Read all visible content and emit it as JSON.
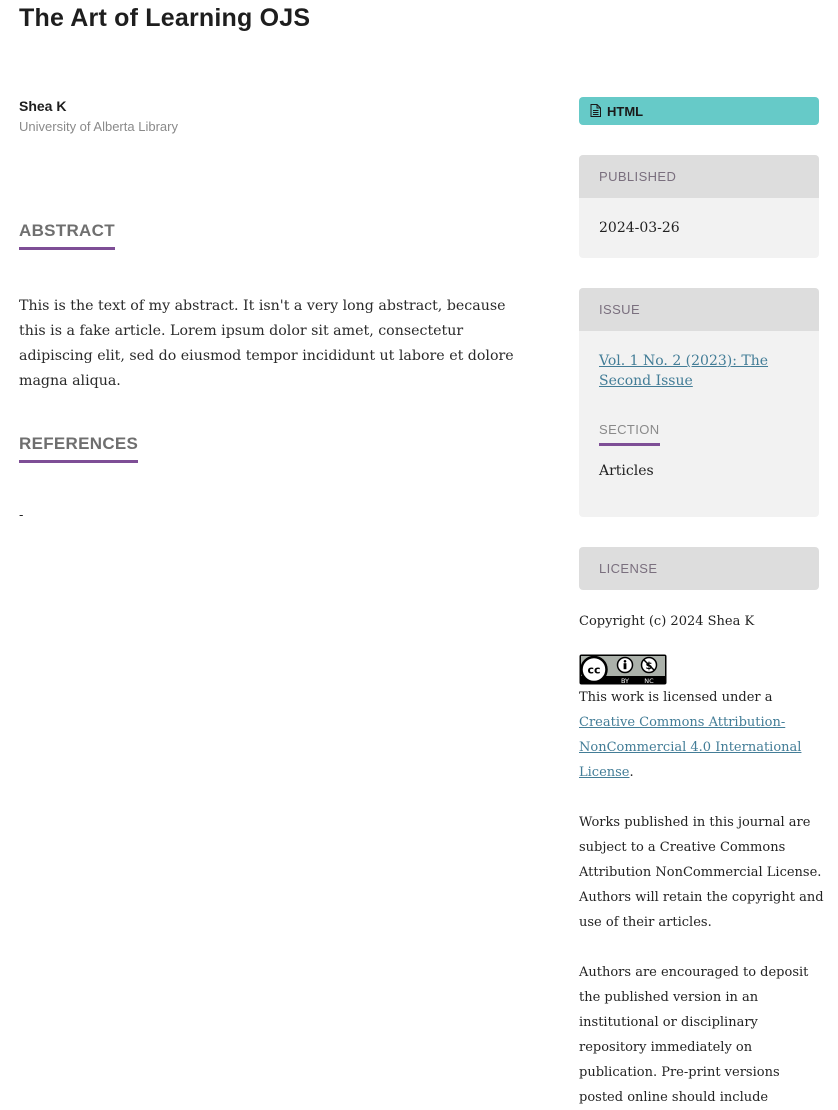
{
  "article": {
    "title": "The Art of Learning OJS",
    "author": {
      "name": "Shea K",
      "affiliation": "University of Alberta Library"
    },
    "abstract": {
      "heading": "ABSTRACT",
      "text": "This is the text of my abstract. It isn't a very long abstract, because this is a fake article. Lorem ipsum dolor sit amet, consectetur adipiscing elit, sed do eiusmod tempor incididunt ut labore et dolore magna aliqua."
    },
    "references": {
      "heading": "REFERENCES",
      "text": "-"
    }
  },
  "sidebar": {
    "galley": {
      "icon": "file-icon",
      "label": "HTML",
      "color": "#66cac8"
    },
    "published": {
      "heading": "PUBLISHED",
      "value": "2024-03-26"
    },
    "issue": {
      "heading": "ISSUE",
      "link_text": "Vol. 1 No. 2 (2023): The Second Issue",
      "section_heading": "SECTION",
      "section_value": "Articles"
    },
    "license": {
      "heading": "LICENSE",
      "copyright": "Copyright (c) 2024 Shea K",
      "badge": {
        "icon": "cc-by-nc-icon",
        "labels": [
          "BY",
          "NC"
        ]
      },
      "text_before": "This work is licensed under a ",
      "link_text": "Creative Commons Attribution-NonCommercial 4.0 International License",
      "text_after": ".",
      "para1": "Works published in this journal are subject to a Creative Commons Attribution NonCommercial License. Authors will retain the copyright and use of their articles.",
      "para2": "Authors are encouraged to deposit the published version in an institutional or disciplinary repository immediately on publication. Pre-print versions posted online should include"
    }
  },
  "colors": {
    "accent": "#7e4e96",
    "link": "#437d97",
    "panel_bg": "#f2f2f2",
    "panel_head_bg": "#dddddd"
  }
}
